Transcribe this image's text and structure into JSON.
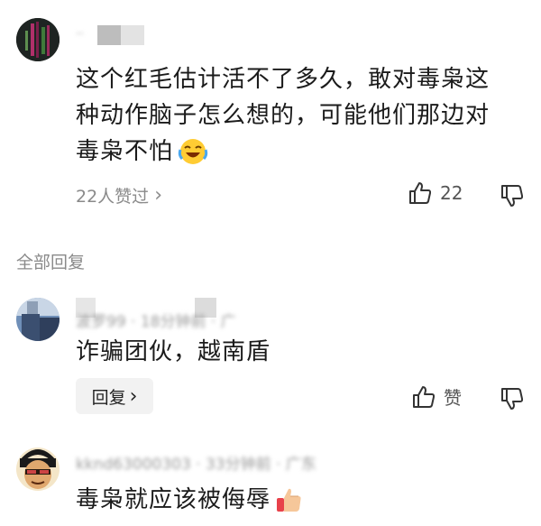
{
  "main_comment": {
    "username": "·· ",
    "text_lines": [
      "这个红毛估计活不了多久，敢对毒枭这",
      "种动作脑子怎么想的，可能他们那边对",
      "毒枭不怕"
    ],
    "emoji": "laughing-crying-emoji",
    "likes_summary": "22人赞过",
    "likes_summary_chevron": "›",
    "like_count": "22"
  },
  "section_header": "全部回复",
  "replies": [
    {
      "username": "波罗99 · 18分钟前 · 广",
      "text": "诈骗团伙，越南盾",
      "reply_button": "回复",
      "reply_chevron": "›",
      "like_label": "赞"
    },
    {
      "username": "kknd63000303 · 33分钟前 · 广东",
      "text": "毒枭就应该被侮辱",
      "emoji": "thumbs-up-emoji"
    }
  ],
  "colors": {
    "text": "#1b1b1b",
    "secondary": "#8a8a8a",
    "reply_button_bg": "#f2f2f2"
  }
}
